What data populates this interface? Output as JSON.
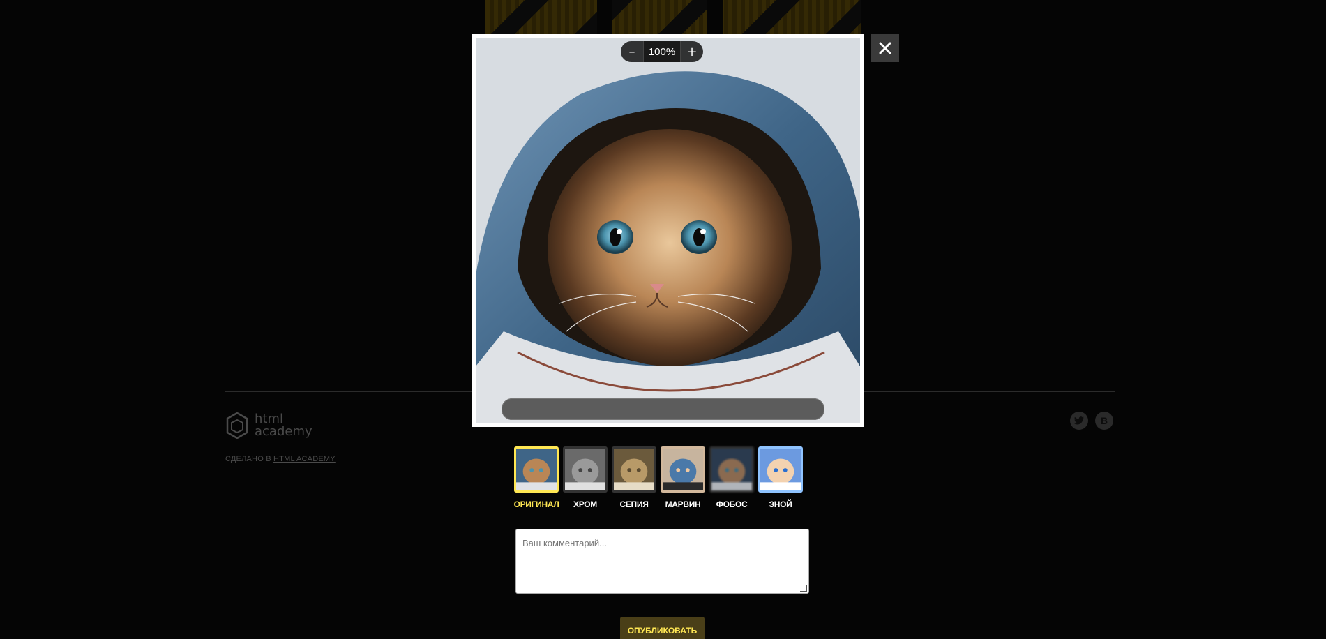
{
  "scale": {
    "decrease_label": "–",
    "value": "100%",
    "increase_label": "+"
  },
  "close": {
    "icon": "close-icon"
  },
  "effects": {
    "items": [
      {
        "label": "ОРИГИНАЛ",
        "active": true
      },
      {
        "label": "ХРОМ",
        "active": false
      },
      {
        "label": "СЕПИЯ",
        "active": false
      },
      {
        "label": "МАРВИН",
        "active": false
      },
      {
        "label": "ФОБОС",
        "active": false
      },
      {
        "label": "ЗНОЙ",
        "active": false
      }
    ]
  },
  "comment": {
    "placeholder": "Ваш комментарий..."
  },
  "submit": {
    "label": "ОПУБЛИКОВАТЬ"
  },
  "background": {
    "logo_text": "html academy",
    "credit_prefix": "СДЕЛАНО В",
    "credit_link": "HTML ACADEMY",
    "social": [
      "twitter-icon",
      "vk-icon"
    ],
    "social_vk_label": "В"
  },
  "colors": {
    "accent": "#ffe753",
    "overlay": "#050505",
    "submit_bg": "#4a3f18"
  }
}
